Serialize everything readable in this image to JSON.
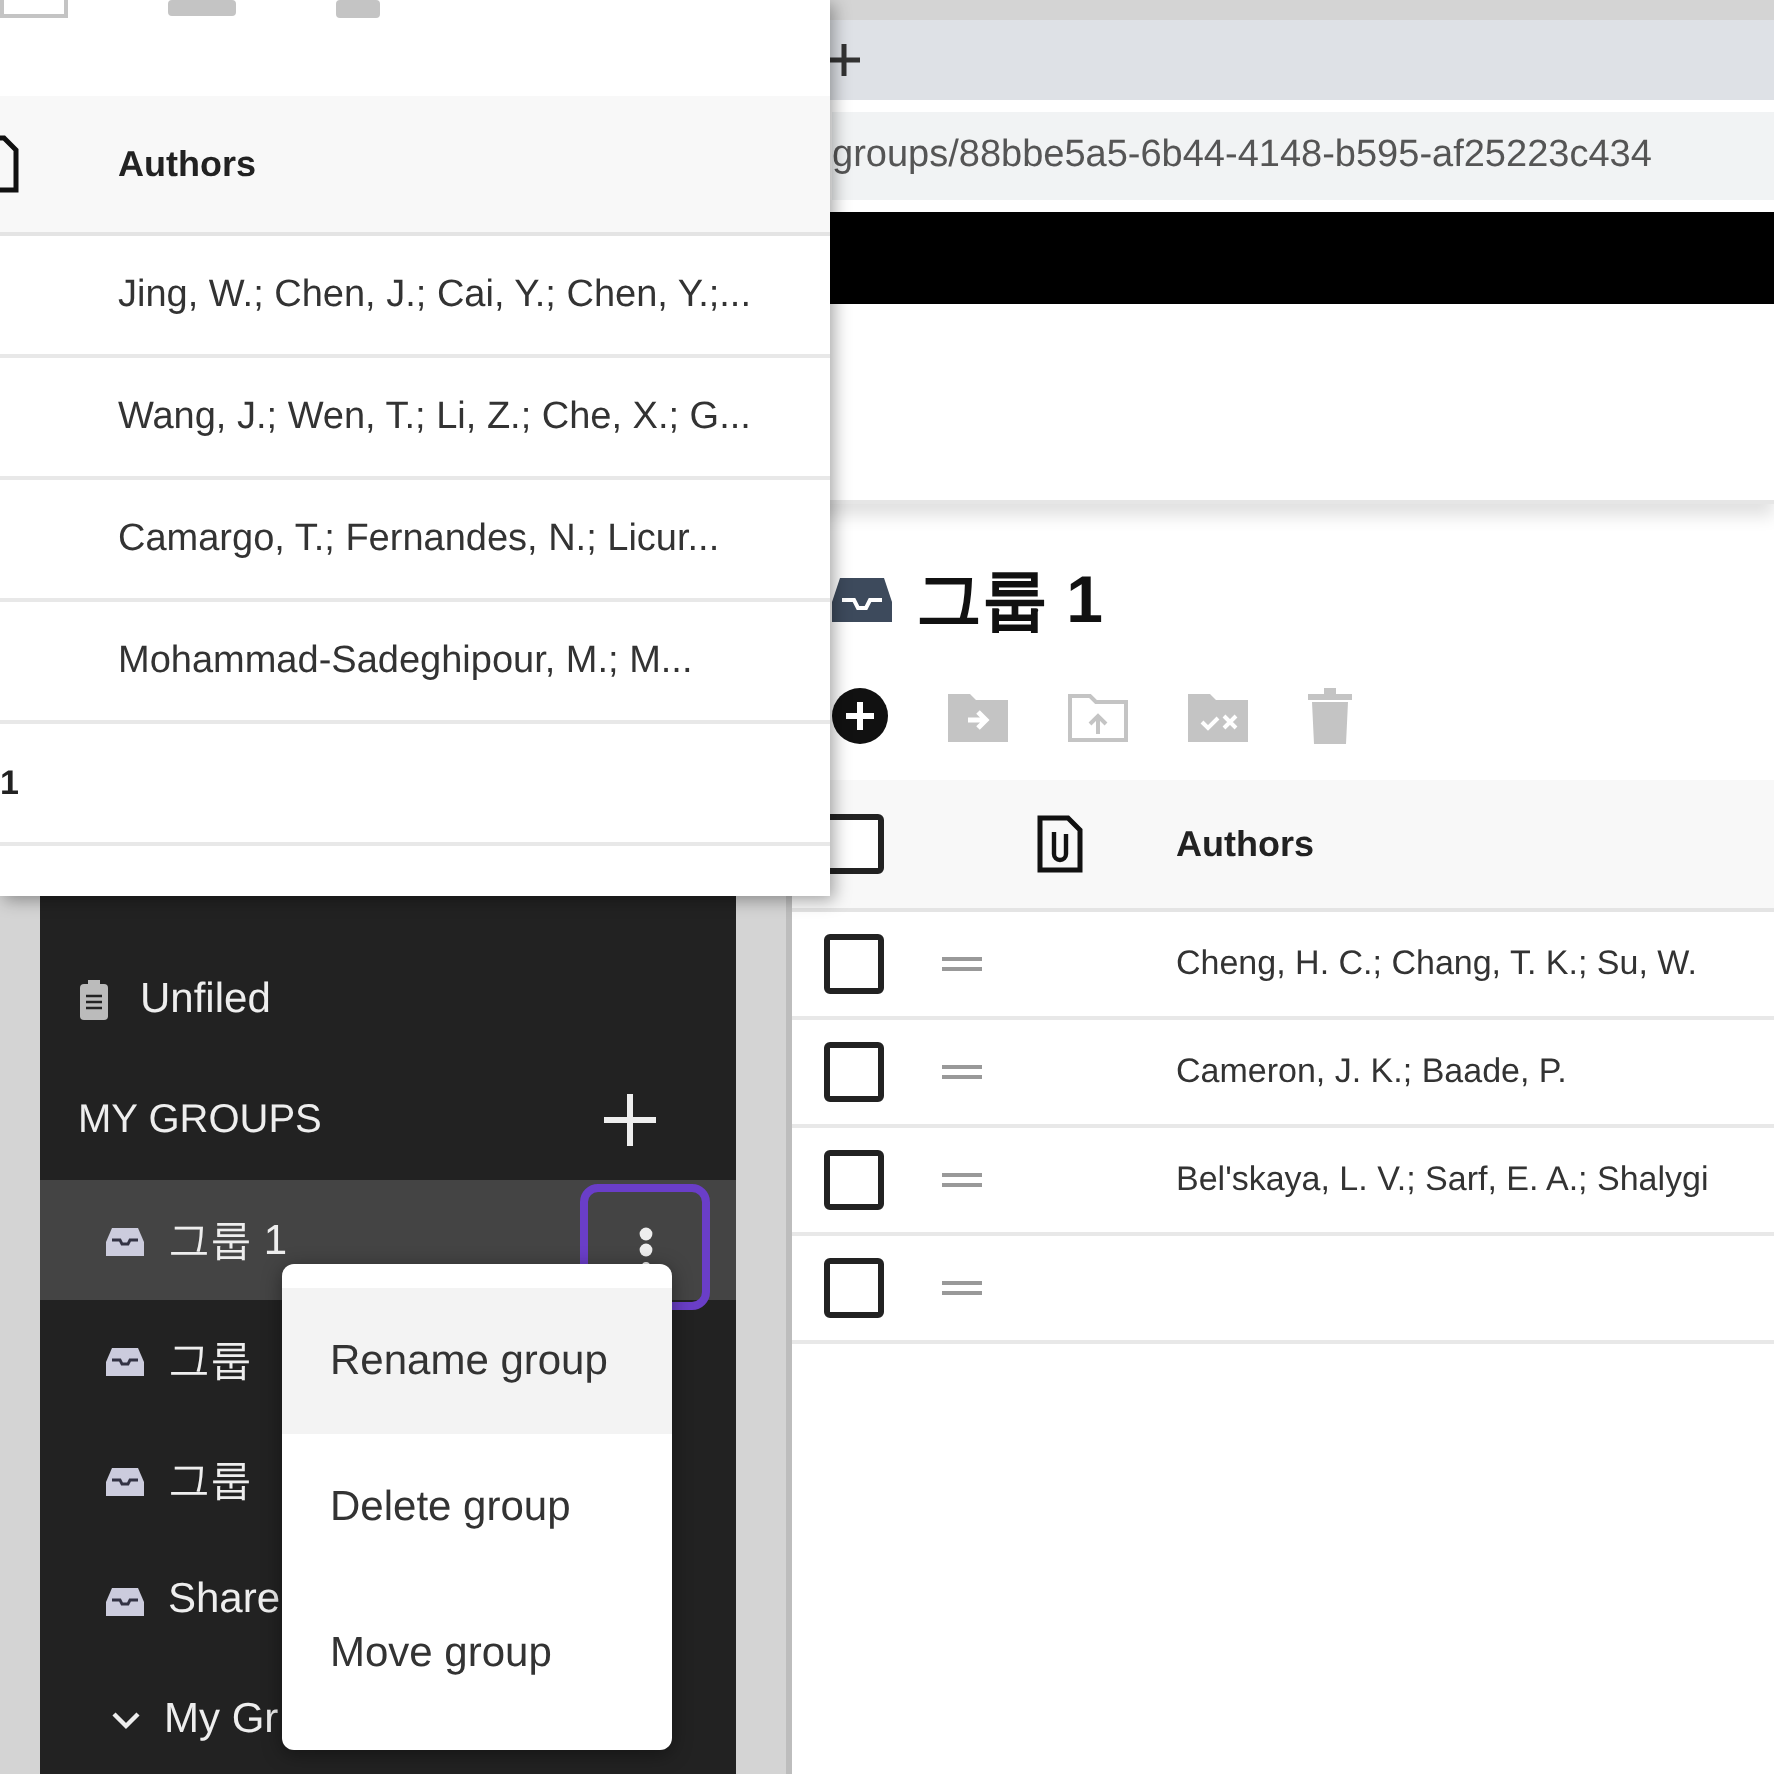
{
  "list_panel": {
    "header": {
      "authors": "Authors"
    },
    "rows": [
      {
        "authors": "Jing, W.; Chen, J.; Cai, Y.; Chen, Y.;..."
      },
      {
        "authors": "Wang, J.; Wen, T.; Li, Z.; Che, X.; G..."
      },
      {
        "authors": "Camargo, T.; Fernandes, N.; Licur..."
      },
      {
        "authors": "Mohammad-Sadeghipour, M.; M..."
      },
      {
        "column_1": "1"
      }
    ]
  },
  "browser": {
    "address": "groups/88bbe5a5-6b44-4148-b595-af25223c434"
  },
  "page": {
    "title": "그룹 1",
    "table": {
      "header": {
        "checked": false,
        "authors": "Authors"
      },
      "rows": [
        {
          "checked": false,
          "authors": "Cheng, H. C.; Chang, T. K.; Su, W."
        },
        {
          "checked": false,
          "authors": "Cameron, J. K.; Baade, P."
        },
        {
          "checked": false,
          "authors": "Bel'skaya, L. V.; Sarf, E. A.; Shalygi"
        },
        {
          "checked": false
        }
      ]
    }
  },
  "sidebar": {
    "unfiled": "Unfiled",
    "section": "MY GROUPS",
    "groups": [
      {
        "label": "그룹 1",
        "selected": true
      },
      {
        "label": "그룹",
        "selected": false
      },
      {
        "label": "그룹",
        "selected": false
      },
      {
        "label": "Share",
        "selected": false
      }
    ],
    "tree": {
      "label": "My Gr",
      "expanded": true
    }
  },
  "menu": {
    "items": [
      {
        "label": "Rename group",
        "selected": true
      },
      {
        "label": "Delete group",
        "selected": false
      },
      {
        "label": "Move group",
        "selected": false
      }
    ]
  }
}
